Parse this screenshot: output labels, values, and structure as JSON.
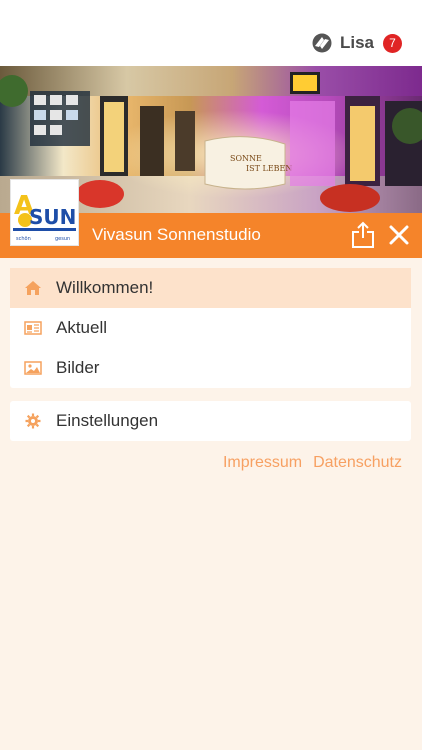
{
  "header": {
    "user_name": "Lisa",
    "notification_count": "7",
    "user_icon": "app-logo-icon"
  },
  "studio": {
    "logo_text": "SUN",
    "logo_subtext_left": "schön",
    "logo_subtext_right": "gesun",
    "sign_line1": "SONNE",
    "sign_line2": "IST LEBEN",
    "title": "Vivasun Sonnenstudio",
    "share_icon": "share-icon",
    "close_icon": "close-icon",
    "accent_color": "#f5842a"
  },
  "menu": {
    "items": [
      {
        "label": "Willkommen!",
        "icon": "home-icon",
        "active": true
      },
      {
        "label": "Aktuell",
        "icon": "newspaper-icon",
        "active": false
      },
      {
        "label": "Bilder",
        "icon": "image-icon",
        "active": false
      }
    ],
    "settings": {
      "label": "Einstellungen",
      "icon": "gear-icon"
    }
  },
  "footer": {
    "impressum": "Impressum",
    "datenschutz": "Datenschutz"
  }
}
